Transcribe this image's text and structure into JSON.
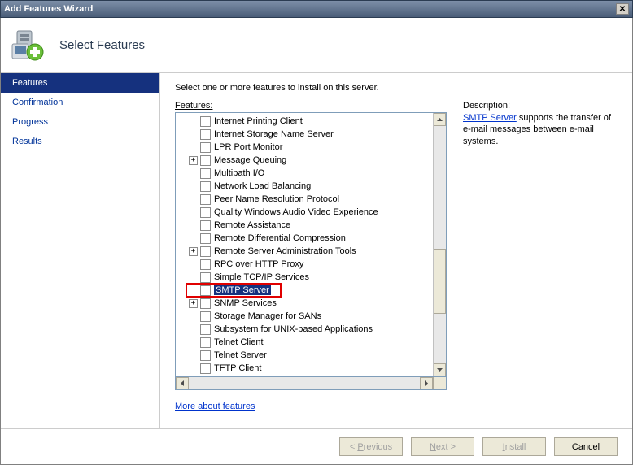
{
  "titlebar": {
    "title": "Add Features Wizard"
  },
  "header": {
    "title": "Select Features"
  },
  "sidebar": {
    "items": [
      {
        "label": "Features",
        "active": true
      },
      {
        "label": "Confirmation",
        "active": false
      },
      {
        "label": "Progress",
        "active": false
      },
      {
        "label": "Results",
        "active": false
      }
    ]
  },
  "main": {
    "instruction": "Select one or more features to install on this server.",
    "features_label": "Features:",
    "description_label": "Description:",
    "more_link": "More about features",
    "tree": [
      {
        "label": "Internet Printing Client",
        "expander": null
      },
      {
        "label": "Internet Storage Name Server",
        "expander": null
      },
      {
        "label": "LPR Port Monitor",
        "expander": null
      },
      {
        "label": "Message Queuing",
        "expander": "+"
      },
      {
        "label": "Multipath I/O",
        "expander": null
      },
      {
        "label": "Network Load Balancing",
        "expander": null
      },
      {
        "label": "Peer Name Resolution Protocol",
        "expander": null
      },
      {
        "label": "Quality Windows Audio Video Experience",
        "expander": null
      },
      {
        "label": "Remote Assistance",
        "expander": null
      },
      {
        "label": "Remote Differential Compression",
        "expander": null
      },
      {
        "label": "Remote Server Administration Tools",
        "expander": "+"
      },
      {
        "label": "RPC over HTTP Proxy",
        "expander": null
      },
      {
        "label": "Simple TCP/IP Services",
        "expander": null
      },
      {
        "label": "SMTP Server",
        "expander": null,
        "selected": true,
        "highlighted": true
      },
      {
        "label": "SNMP Services",
        "expander": "+"
      },
      {
        "label": "Storage Manager for SANs",
        "expander": null
      },
      {
        "label": "Subsystem for UNIX-based Applications",
        "expander": null
      },
      {
        "label": "Telnet Client",
        "expander": null
      },
      {
        "label": "Telnet Server",
        "expander": null
      },
      {
        "label": "TFTP Client",
        "expander": null
      }
    ]
  },
  "description": {
    "link_text": "SMTP Server",
    "rest": " supports the transfer of e-mail messages between e-mail systems."
  },
  "buttons": {
    "previous": "< Previous",
    "next": "Next >",
    "install": "Install",
    "cancel": "Cancel"
  }
}
